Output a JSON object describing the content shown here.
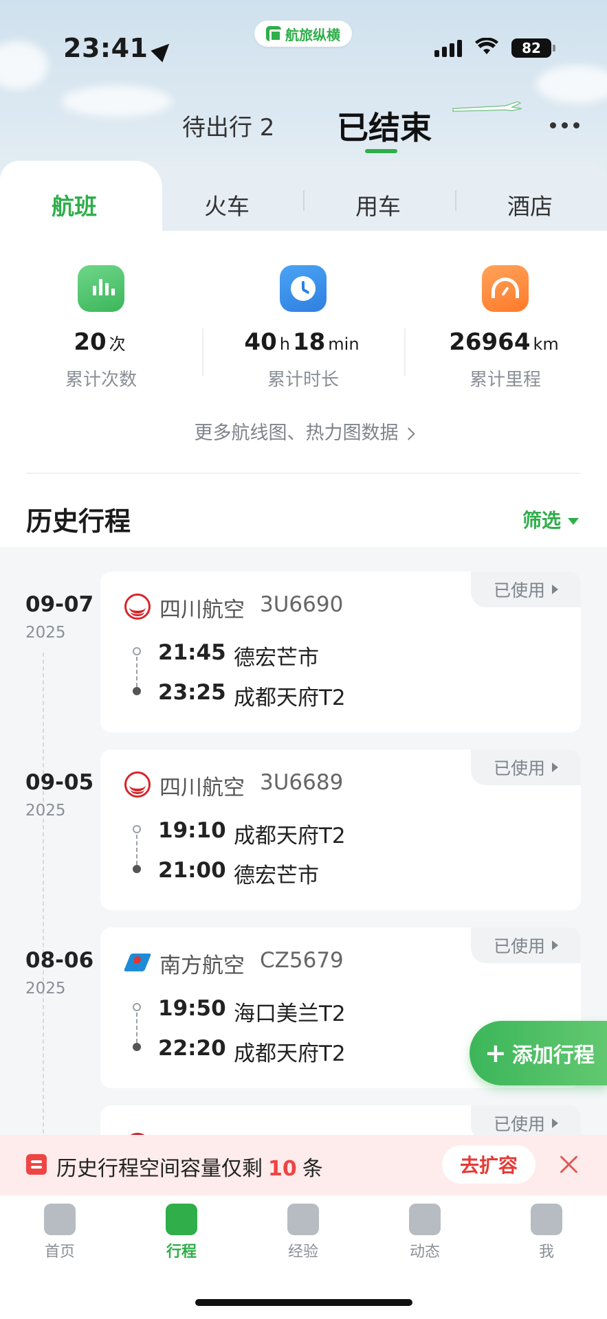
{
  "status_bar": {
    "time": "23:41",
    "battery": "82",
    "app_badge": "航旅纵横"
  },
  "top_tabs": {
    "pending": "待出行 2",
    "ended": "已结束"
  },
  "categories": [
    "航班",
    "火车",
    "用车",
    "酒店"
  ],
  "stats": {
    "count": {
      "value": "20",
      "unit": "次",
      "label": "累计次数"
    },
    "duration": {
      "hours": "40",
      "h_unit": "h",
      "minutes": "18",
      "m_unit": "min",
      "label": "累计时长"
    },
    "distance": {
      "value": "26964",
      "unit": "km",
      "label": "累计里程"
    }
  },
  "more_link": "更多航线图、热力图数据",
  "history": {
    "title": "历史行程",
    "filter": "筛选"
  },
  "used_label": "已使用",
  "trips": [
    {
      "md": "09-07",
      "year": "2025",
      "airline": "四川航空",
      "flight": "3U6690",
      "dep_time": "21:45",
      "dep_place": "德宏芒市",
      "arr_time": "23:25",
      "arr_place": "成都天府T2"
    },
    {
      "md": "09-05",
      "year": "2025",
      "airline": "四川航空",
      "flight": "3U6689",
      "dep_time": "19:10",
      "dep_place": "成都天府T2",
      "arr_time": "21:00",
      "arr_place": "德宏芒市"
    },
    {
      "md": "08-06",
      "year": "2025",
      "airline": "南方航空",
      "flight": "CZ5679",
      "dep_time": "19:50",
      "dep_place": "海口美兰T2",
      "arr_time": "22:20",
      "arr_place": "成都天府T2"
    }
  ],
  "add_trip": "添加行程",
  "capacity": {
    "text_before": "历史行程空间容量仅剩",
    "count": "10",
    "text_after": "条",
    "button": "去扩容"
  },
  "bottom_nav": [
    "首页",
    "行程",
    "经验",
    "动态",
    "我"
  ],
  "colors": {
    "accent": "#2fae4a",
    "alert": "#ef4444"
  }
}
